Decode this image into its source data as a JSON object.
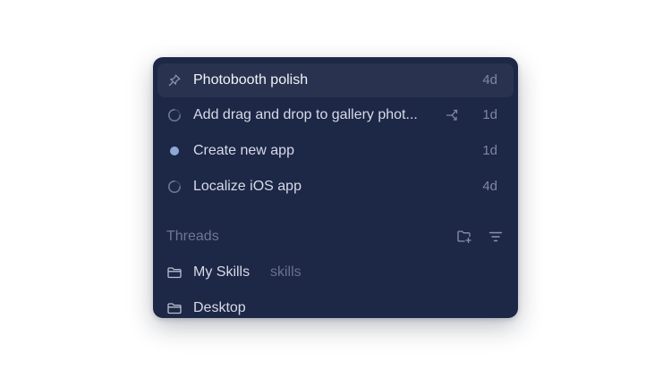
{
  "recent": [
    {
      "label": "Photobooth polish",
      "time": "4d",
      "icon": "pin-icon",
      "selected": true
    },
    {
      "label": "Add drag and drop to gallery phot...",
      "time": "1d",
      "icon": "spinner-icon",
      "extra_icon": "branch-icon"
    },
    {
      "label": "Create new app",
      "time": "1d",
      "icon": "unread-dot-icon"
    },
    {
      "label": "Localize iOS app",
      "time": "4d",
      "icon": "spinner-icon"
    }
  ],
  "threads": {
    "title": "Threads",
    "actions": [
      "new-folder-icon",
      "filter-icon"
    ],
    "items": [
      {
        "label": "My Skills",
        "sublabel": "skills",
        "icon": "folder-icon"
      },
      {
        "label": "Desktop",
        "icon": "folder-icon"
      }
    ]
  },
  "colors": {
    "panel_bg": "#1d2746",
    "selected_bg": "#29334f",
    "text": "#d6dbe8",
    "muted": "#7f889f",
    "accent_dot": "#8ea8d6"
  }
}
